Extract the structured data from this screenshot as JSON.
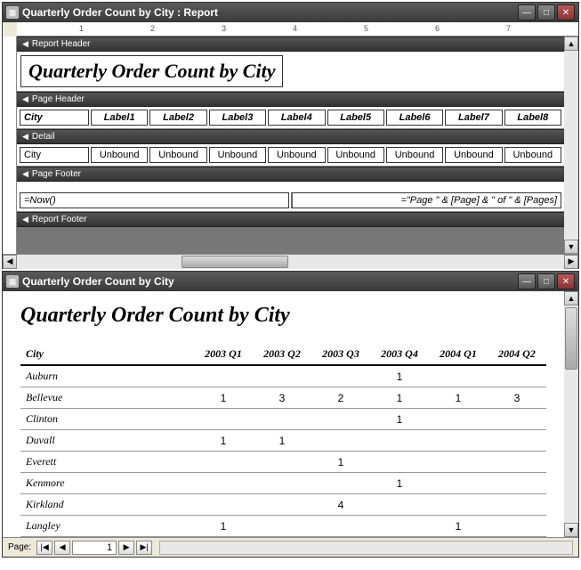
{
  "design_window": {
    "title": "Quarterly Order Count by City : Report",
    "report_header_label": "Report Header",
    "title_box": "Quarterly Order Count by City",
    "page_header_label": "Page Header",
    "columns": {
      "city": "City",
      "labels": [
        "Label1",
        "Label2",
        "Label3",
        "Label4",
        "Label5",
        "Label6",
        "Label7",
        "Label8"
      ]
    },
    "detail_label": "Detail",
    "detail_row": {
      "city": "City",
      "unbound": "Unbound"
    },
    "page_footer_label": "Page Footer",
    "footer_left": "=Now()",
    "footer_right": "=\"Page \" & [Page] & \" of \" & [Pages]",
    "report_footer_label": "Report Footer"
  },
  "preview_window": {
    "title": "Quarterly Order Count by City",
    "doc_title": "Quarterly Order Count by City",
    "columns": [
      "City",
      "2003 Q1",
      "2003 Q2",
      "2003 Q3",
      "2003 Q4",
      "2004 Q1",
      "2004 Q2"
    ],
    "rows": [
      {
        "city": "Auburn",
        "v": [
          "",
          "",
          "",
          "1",
          "",
          ""
        ]
      },
      {
        "city": "Bellevue",
        "v": [
          "1",
          "3",
          "2",
          "1",
          "1",
          "3"
        ]
      },
      {
        "city": "Clinton",
        "v": [
          "",
          "",
          "",
          "1",
          "",
          ""
        ]
      },
      {
        "city": "Duvall",
        "v": [
          "1",
          "1",
          "",
          "",
          "",
          ""
        ]
      },
      {
        "city": "Everett",
        "v": [
          "",
          "",
          "1",
          "",
          "",
          ""
        ]
      },
      {
        "city": "Kenmore",
        "v": [
          "",
          "",
          "",
          "1",
          "",
          ""
        ]
      },
      {
        "city": "Kirkland",
        "v": [
          "",
          "",
          "4",
          "",
          "",
          ""
        ]
      },
      {
        "city": "Langley",
        "v": [
          "1",
          "",
          "",
          "",
          "1",
          ""
        ]
      }
    ],
    "nav": {
      "label": "Page:",
      "value": "1"
    }
  },
  "chart_data": {
    "type": "table",
    "title": "Quarterly Order Count by City",
    "columns": [
      "City",
      "2003 Q1",
      "2003 Q2",
      "2003 Q3",
      "2003 Q4",
      "2004 Q1",
      "2004 Q2"
    ],
    "rows": [
      [
        "Auburn",
        null,
        null,
        null,
        1,
        null,
        null
      ],
      [
        "Bellevue",
        1,
        3,
        2,
        1,
        1,
        3
      ],
      [
        "Clinton",
        null,
        null,
        null,
        1,
        null,
        null
      ],
      [
        "Duvall",
        1,
        1,
        null,
        null,
        null,
        null
      ],
      [
        "Everett",
        null,
        null,
        1,
        null,
        null,
        null
      ],
      [
        "Kenmore",
        null,
        null,
        null,
        1,
        null,
        null
      ],
      [
        "Kirkland",
        null,
        null,
        4,
        null,
        null,
        null
      ],
      [
        "Langley",
        1,
        null,
        null,
        null,
        1,
        null
      ]
    ]
  }
}
